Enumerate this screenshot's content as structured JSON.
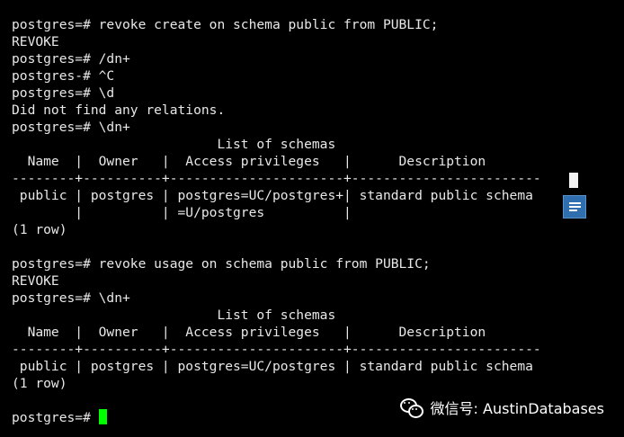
{
  "terminal": {
    "lines": [
      "postgres=# revoke create on schema public from PUBLIC;",
      "REVOKE",
      "postgres=# /dn+",
      "postgres-# ^C",
      "postgres=# \\d",
      "Did not find any relations.",
      "postgres=# \\dn+",
      "                          List of schemas",
      "  Name  |  Owner   |  Access privileges   |      Description",
      "--------+----------+----------------------+------------------------",
      " public | postgres | postgres=UC/postgres+| standard public schema",
      "        |          | =U/postgres          |",
      "(1 row)",
      "",
      "postgres=# revoke usage on schema public from PUBLIC;",
      "REVOKE",
      "postgres=# \\dn+",
      "                          List of schemas",
      "  Name  |  Owner   |  Access privileges   |      Description",
      "--------+----------+----------------------+------------------------",
      " public | postgres | postgres=UC/postgres | standard public schema",
      "(1 row)",
      "",
      "postgres=# "
    ],
    "cursor_color": "#00ff00"
  },
  "watermark": {
    "label": "微信号: AustinDatabases",
    "icon": "wechat-icon"
  },
  "overlay": {
    "icon": "document-icon",
    "icon_color": "#2f6fb0"
  }
}
